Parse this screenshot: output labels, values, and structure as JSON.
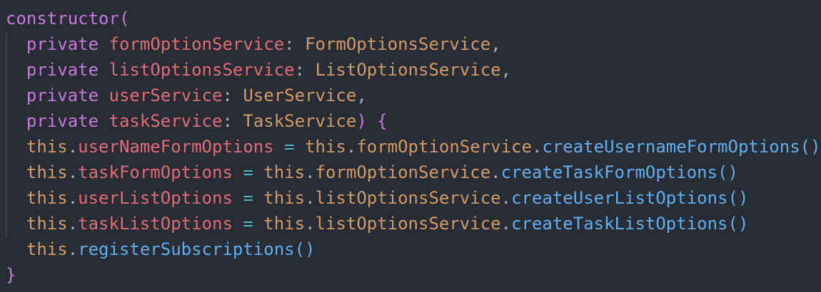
{
  "code": {
    "lines": [
      [
        {
          "t": "constructor(",
          "c": "kw"
        }
      ],
      [
        {
          "t": "  ",
          "c": "punc"
        },
        {
          "t": "private",
          "c": "kw"
        },
        {
          "t": " ",
          "c": "punc"
        },
        {
          "t": "formOptionService",
          "c": "prop"
        },
        {
          "t": ": ",
          "c": "punc"
        },
        {
          "t": "FormOptionsService",
          "c": "type"
        },
        {
          "t": ",",
          "c": "punc"
        }
      ],
      [
        {
          "t": "  ",
          "c": "punc"
        },
        {
          "t": "private",
          "c": "kw"
        },
        {
          "t": " ",
          "c": "punc"
        },
        {
          "t": "listOptionsService",
          "c": "prop"
        },
        {
          "t": ": ",
          "c": "punc"
        },
        {
          "t": "ListOptionsService",
          "c": "type"
        },
        {
          "t": ",",
          "c": "punc"
        }
      ],
      [
        {
          "t": "  ",
          "c": "punc"
        },
        {
          "t": "private",
          "c": "kw"
        },
        {
          "t": " ",
          "c": "punc"
        },
        {
          "t": "userService",
          "c": "prop"
        },
        {
          "t": ": ",
          "c": "punc"
        },
        {
          "t": "UserService",
          "c": "type"
        },
        {
          "t": ",",
          "c": "punc"
        }
      ],
      [
        {
          "t": "  ",
          "c": "punc"
        },
        {
          "t": "private",
          "c": "kw"
        },
        {
          "t": " ",
          "c": "punc"
        },
        {
          "t": "taskService",
          "c": "prop"
        },
        {
          "t": ": ",
          "c": "punc"
        },
        {
          "t": "TaskService",
          "c": "type"
        },
        {
          "t": ")",
          "c": "kw"
        },
        {
          "t": " ",
          "c": "punc"
        },
        {
          "t": "{",
          "c": "brace"
        }
      ],
      [
        {
          "t": "  ",
          "c": "punc"
        },
        {
          "t": "this",
          "c": "this"
        },
        {
          "t": ".",
          "c": "punc"
        },
        {
          "t": "userNameFormOptions",
          "c": "prop"
        },
        {
          "t": " ",
          "c": "punc"
        },
        {
          "t": "=",
          "c": "op"
        },
        {
          "t": " ",
          "c": "punc"
        },
        {
          "t": "this",
          "c": "this"
        },
        {
          "t": ".",
          "c": "punc"
        },
        {
          "t": "formOptionService",
          "c": "this"
        },
        {
          "t": ".",
          "c": "punc"
        },
        {
          "t": "createUsernameFormOptions()",
          "c": "fn"
        }
      ],
      [
        {
          "t": "  ",
          "c": "punc"
        },
        {
          "t": "this",
          "c": "this"
        },
        {
          "t": ".",
          "c": "punc"
        },
        {
          "t": "taskFormOptions",
          "c": "prop"
        },
        {
          "t": " ",
          "c": "punc"
        },
        {
          "t": "=",
          "c": "op"
        },
        {
          "t": " ",
          "c": "punc"
        },
        {
          "t": "this",
          "c": "this"
        },
        {
          "t": ".",
          "c": "punc"
        },
        {
          "t": "formOptionService",
          "c": "this"
        },
        {
          "t": ".",
          "c": "punc"
        },
        {
          "t": "createTaskFormOptions()",
          "c": "fn"
        }
      ],
      [
        {
          "t": "  ",
          "c": "punc"
        },
        {
          "t": "this",
          "c": "this"
        },
        {
          "t": ".",
          "c": "punc"
        },
        {
          "t": "userListOptions",
          "c": "prop"
        },
        {
          "t": " ",
          "c": "punc"
        },
        {
          "t": "=",
          "c": "op"
        },
        {
          "t": " ",
          "c": "punc"
        },
        {
          "t": "this",
          "c": "this"
        },
        {
          "t": ".",
          "c": "punc"
        },
        {
          "t": "listOptionsService",
          "c": "this"
        },
        {
          "t": ".",
          "c": "punc"
        },
        {
          "t": "createUserListOptions()",
          "c": "fn"
        }
      ],
      [
        {
          "t": "  ",
          "c": "punc"
        },
        {
          "t": "this",
          "c": "this"
        },
        {
          "t": ".",
          "c": "punc"
        },
        {
          "t": "taskListOptions",
          "c": "prop"
        },
        {
          "t": " ",
          "c": "punc"
        },
        {
          "t": "=",
          "c": "op"
        },
        {
          "t": " ",
          "c": "punc"
        },
        {
          "t": "this",
          "c": "this"
        },
        {
          "t": ".",
          "c": "punc"
        },
        {
          "t": "listOptionsService",
          "c": "this"
        },
        {
          "t": ".",
          "c": "punc"
        },
        {
          "t": "createTaskListOptions()",
          "c": "fn"
        }
      ],
      [
        {
          "t": "  ",
          "c": "punc"
        },
        {
          "t": "this",
          "c": "this"
        },
        {
          "t": ".",
          "c": "punc"
        },
        {
          "t": "registerSubscriptions()",
          "c": "fn"
        }
      ],
      [
        {
          "t": "}",
          "c": "brace"
        }
      ]
    ]
  },
  "colors": {
    "background": "#282c34",
    "keyword": "#c678dd",
    "property": "#e06c75",
    "type": "#d19a66",
    "function": "#61afef",
    "operator": "#56b6c2"
  }
}
